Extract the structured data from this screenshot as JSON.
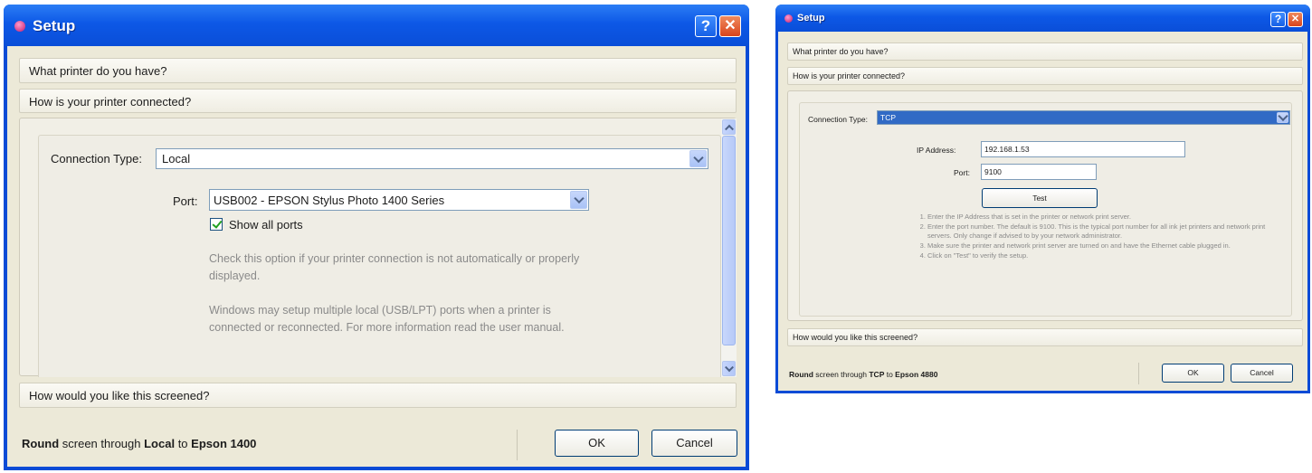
{
  "left": {
    "title": "Setup",
    "help_label": "?",
    "close_label": "✕",
    "sections": {
      "printer": "What printer do you have?",
      "connected": "How is your printer connected?",
      "screened": "How would you like this screened?"
    },
    "connection_type_label": "Connection Type:",
    "connection_type_value": "Local",
    "port_label": "Port:",
    "port_value": "USB002 - EPSON Stylus Photo 1400 Series",
    "show_all_ports_label": "Show all ports",
    "show_all_ports_checked": true,
    "hint1": "Check this option if your printer connection is not automatically or properly displayed.",
    "hint2": "Windows may setup multiple local (USB/LPT) ports when a printer is connected or reconnected. For more information read the user manual.",
    "status": {
      "prefix": "Round",
      "mid1": " screen through ",
      "method": "Local",
      "mid2": " to ",
      "printer": "Epson 1400"
    },
    "ok_label": "OK",
    "cancel_label": "Cancel"
  },
  "right": {
    "title": "Setup",
    "help_label": "?",
    "close_label": "✕",
    "sections": {
      "printer": "What printer do you have?",
      "connected": "How is your printer connected?",
      "screened": "How would you like this screened?"
    },
    "connection_type_label": "Connection Type:",
    "connection_type_value": "TCP",
    "ip_label": "IP Address:",
    "ip_value": "192.168.1.53",
    "port_label": "Port:",
    "port_value": "9100",
    "test_label": "Test",
    "steps": [
      "Enter the IP Address that is set in the printer or network print server.",
      "Enter the port number. The default is 9100. This is the typical port number for all ink jet printers and network print servers. Only change if advised to by your network administrator.",
      "Make sure the printer and network print server are turned on and have the Ethernet cable plugged in.",
      "Click on \"Test\" to verify the setup."
    ],
    "status": {
      "prefix": "Round",
      "mid1": " screen through ",
      "method": "TCP",
      "mid2": " to ",
      "printer": "Epson 4880"
    },
    "ok_label": "OK",
    "cancel_label": "Cancel"
  }
}
